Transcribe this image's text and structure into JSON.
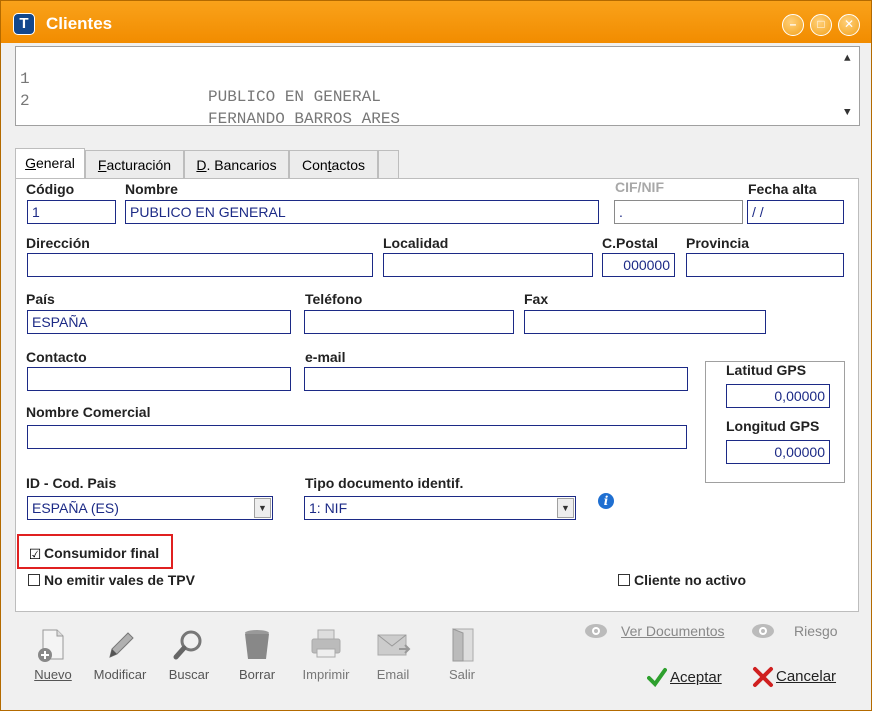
{
  "window": {
    "title": "Clientes",
    "app_icon": "T",
    "minimize": "–",
    "maximize": "□",
    "close": "✕"
  },
  "list": {
    "rows": [
      {
        "num": "1",
        "name": "PUBLICO EN GENERAL"
      },
      {
        "num": "2",
        "name": "FERNANDO BARROS ARES"
      }
    ],
    "scroll_up": "▲",
    "scroll_down": "▼"
  },
  "tabs": [
    {
      "label": "General",
      "underline": "G",
      "rest": "eneral"
    },
    {
      "label": "Facturación",
      "underline": "F",
      "rest": "acturación"
    },
    {
      "label": "D. Bancarios",
      "underline": "D",
      "rest": ". Bancarios"
    },
    {
      "label": "Contactos",
      "pre": "Con",
      "underline": "t",
      "rest": "actos"
    }
  ],
  "form": {
    "codigo_label": "Código",
    "codigo_value": "1",
    "nombre_label": "Nombre",
    "nombre_value": "PUBLICO EN GENERAL",
    "cif_label": "CIF/NIF",
    "cif_value": ".",
    "fecha_label": "Fecha alta",
    "fecha_value": " /  /",
    "direccion_label": "Dirección",
    "direccion_value": "",
    "localidad_label": "Localidad",
    "localidad_value": "",
    "cpostal_label": "C.Postal",
    "cpostal_value": "000000",
    "provincia_label": "Provincia",
    "provincia_value": "",
    "pais_label": "País",
    "pais_value": "ESPAÑA",
    "telefono_label": "Teléfono",
    "telefono_value": "",
    "fax_label": "Fax",
    "fax_value": "",
    "contacto_label": "Contacto",
    "contacto_value": "",
    "email_label": "e-mail",
    "email_value": "",
    "nombre_comercial_label": "Nombre Comercial",
    "nombre_comercial_value": "",
    "latitud_label": "Latitud GPS",
    "latitud_value": "0,00000",
    "longitud_label": "Longitud GPS",
    "longitud_value": "0,00000",
    "id_pais_label": "ID - Cod. Pais",
    "id_pais_value": "ESPAÑA  (ES)",
    "tipo_doc_label": "Tipo documento identif.",
    "tipo_doc_value": "1: NIF",
    "combo_arrow": "▼",
    "info_glyph": "i",
    "consumidor_final_label": "Consumidor final",
    "consumidor_final_checked": "☑",
    "no_emitir_label": "No emitir vales de TPV",
    "cliente_no_activo_label": "Cliente no activo"
  },
  "toolbar": [
    {
      "label": "Nuevo",
      "icon": "new-document-icon"
    },
    {
      "label": "Modificar",
      "icon": "pencil-icon"
    },
    {
      "label": "Buscar",
      "icon": "magnifier-icon"
    },
    {
      "label": "Borrar",
      "icon": "trash-icon"
    },
    {
      "label": "Imprimir",
      "icon": "printer-icon"
    },
    {
      "label": "Email",
      "icon": "envelope-icon"
    },
    {
      "label": "Salir",
      "icon": "door-exit-icon"
    }
  ],
  "links": {
    "ver_documentos": "Ver Documentos",
    "riesgo": "Riesgo"
  },
  "actions": {
    "aceptar": "Aceptar",
    "cancelar": "Cancelar"
  },
  "colors": {
    "titlebar": "#f28c00",
    "field_border": "#1c2a86",
    "highlight": "#e02020",
    "accept_check": "#2ea02e",
    "cancel_x": "#d02020"
  }
}
